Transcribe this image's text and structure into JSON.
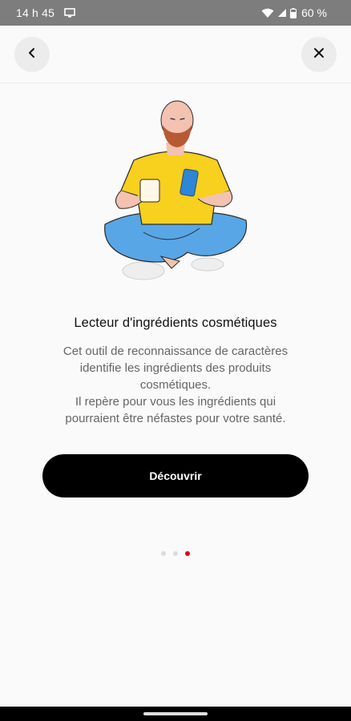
{
  "status_bar": {
    "time": "14 h 45",
    "battery": "60 %",
    "icons": [
      "screen-cast-icon",
      "wifi-icon",
      "signal-icon",
      "battery-icon"
    ]
  },
  "header": {
    "back_icon": "chevron-left-icon",
    "close_icon": "close-icon"
  },
  "content": {
    "title": "Lecteur d'ingrédients cosmétiques",
    "description_lines": [
      "Cet outil de reconnaissance de caractères",
      "identifie les ingrédients des produits",
      "cosmétiques.",
      "Il repère pour vous les ingrédients qui",
      "pourraient être néfastes pour votre santé."
    ],
    "cta_label": "Découvrir"
  },
  "pagination": {
    "total": 3,
    "active_index": 2,
    "active_color": "#e3001b",
    "inactive_color": "#dcdcdc"
  },
  "colors": {
    "shirt": "#f8d01e",
    "pants": "#58a6e6",
    "phone": "#2f86d6",
    "skin": "#f3c2b0",
    "beard": "#b65a34",
    "cta_bg": "#000000"
  }
}
